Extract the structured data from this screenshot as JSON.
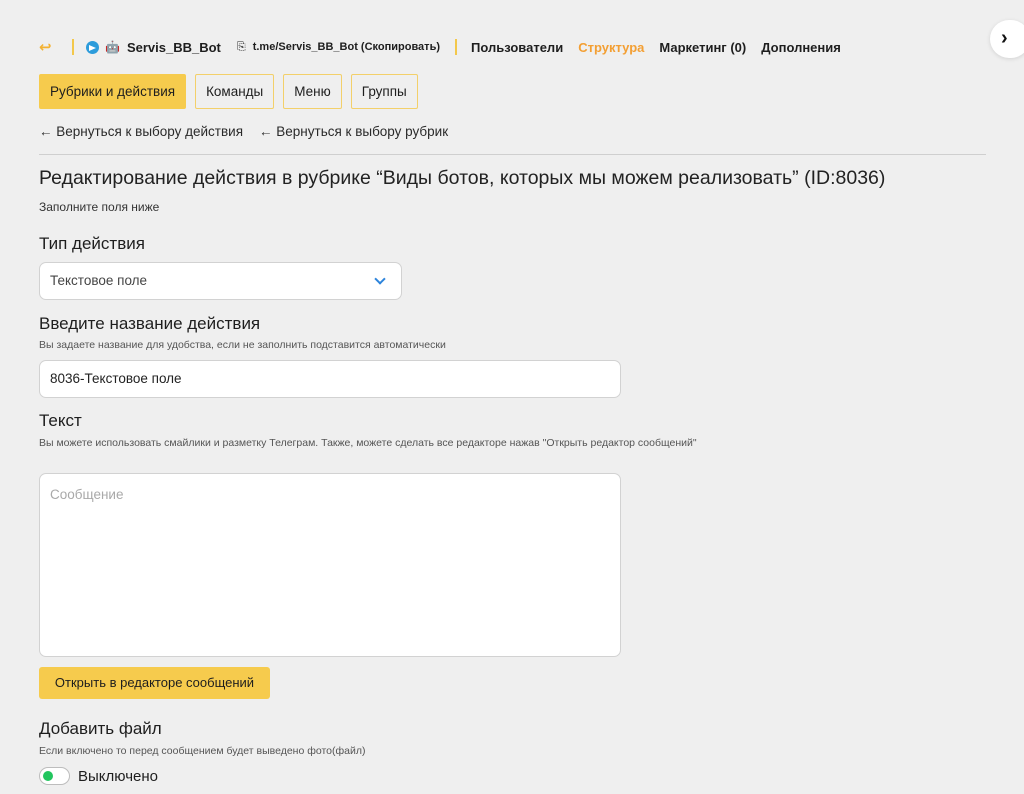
{
  "header": {
    "back_icon": "↩",
    "bot_name": "Servis_BB_Bot",
    "bot_link": "t.me/Servis_BB_Bot (Скопировать)",
    "nav": [
      {
        "label": "Пользователи",
        "active": false
      },
      {
        "label": "Структура",
        "active": true
      },
      {
        "label": "Маркетинг (0)",
        "active": false
      },
      {
        "label": "Дополнения",
        "active": false
      }
    ],
    "accent_color": "#f39f33"
  },
  "tabs": [
    {
      "label": "Рубрики и действия",
      "active": true
    },
    {
      "label": "Команды",
      "active": false
    },
    {
      "label": "Меню",
      "active": false
    },
    {
      "label": "Группы",
      "active": false
    }
  ],
  "backlinks": {
    "action": "← Вернуться к выбору действия",
    "rubric": "← Вернуться к выбору рубрик"
  },
  "page": {
    "title": "Редактирование действия в рубрике “Виды ботов, которых мы можем реализовать” (ID:8036)",
    "subtitle": "Заполните поля ниже"
  },
  "action_type": {
    "label": "Тип действия",
    "selected": "Текстовое поле"
  },
  "action_name": {
    "label": "Введите название действия",
    "hint": "Вы задаете название для удобства, если не заполнить подставится автоматически",
    "value": "8036-Текстовое поле"
  },
  "text": {
    "label": "Текст",
    "hint": "Вы можете использовать смайлики и разметку Телеграм. Также, можете сделать все редакторе нажав \"Открыть редактор сообщений\"",
    "placeholder": "Сообщение",
    "open_editor_label": "Открыть в редакторе сообщений"
  },
  "add_file": {
    "label": "Добавить файл",
    "hint": "Если включено то перед сообщением будет выведено фото(файл)",
    "toggle_label": "Выключено"
  },
  "next_icon": "›"
}
